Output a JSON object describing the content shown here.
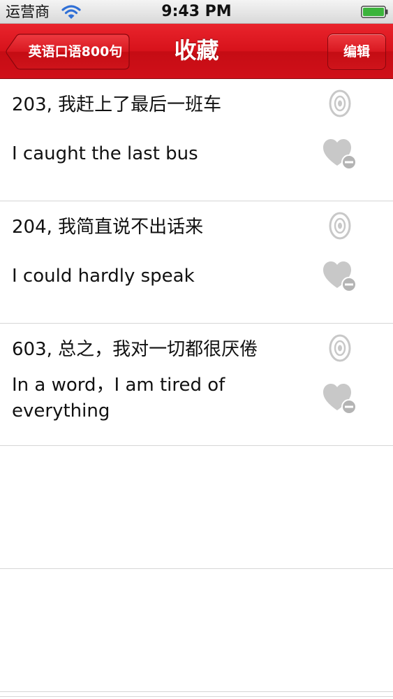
{
  "status_bar": {
    "carrier": "运营商",
    "time": "9:43 PM",
    "wifi_icon": "wifi-icon",
    "battery_icon": "battery-icon"
  },
  "nav": {
    "back_label": "英语口语800句",
    "title": "收藏",
    "edit_label": "编辑",
    "bar_color": "#d7121b"
  },
  "favorites": [
    {
      "chinese": "203, 我赶上了最后一班车",
      "english": "I caught the last bus"
    },
    {
      "chinese": "204, 我简直说不出话来",
      "english": "I could hardly speak"
    },
    {
      "chinese": "603, 总之，我对一切都很厌倦",
      "english": "In a word，I am tired of everything"
    }
  ],
  "row_icons": {
    "play": "speaker-icon",
    "remove": "heart-minus-icon",
    "icon_color": "#c8c8c8"
  }
}
